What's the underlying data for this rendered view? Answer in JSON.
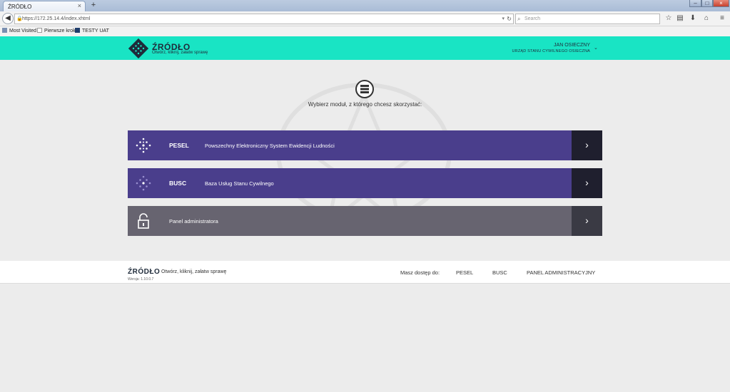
{
  "browser": {
    "tab_title": "ŹRÓDŁO",
    "tab_close": "×",
    "new_tab": "+",
    "url": "https://172.25.14.4/index.xhtml",
    "search_placeholder": "Search",
    "window_controls": {
      "minimize": "–",
      "maximize": "□",
      "close": "×"
    },
    "bookmarks": [
      "Most Visited",
      "Pierwsze kroki",
      "TESTY UAT"
    ]
  },
  "header": {
    "app_name": "ŹRÓDŁO",
    "tagline": "Otwórz, kliknij, załatw sprawę",
    "user_name": "JAN OSIECZNY",
    "user_org": "URZĄD STANU CYWILNEGO OSIECZNA",
    "brand_color": "#19e4c4"
  },
  "main": {
    "prompt": "Wybierz moduł, z którego chcesz skorzystać:",
    "modules": [
      {
        "code": "PESEL",
        "description": "Powszechny Elektroniczny System Ewidencji Ludności",
        "color": "#4a3e8c",
        "icon": "dots-diamond-icon"
      },
      {
        "code": "BUSC",
        "description": "Baza Usług Stanu Cywilnego",
        "color": "#4a3e8c",
        "icon": "dots-diamond-faded-icon"
      },
      {
        "label": "Panel administratora",
        "color": "#676470",
        "icon": "unlock-icon"
      }
    ],
    "arrow": "›"
  },
  "footer": {
    "app_name": "ŹRÓDŁO",
    "tagline": "Otwórz, kliknij, załatw sprawę",
    "version": "Wersja: 1.10.0.7",
    "access_label": "Masz dostęp do:",
    "links": [
      "PESEL",
      "BUSC",
      "PANEL ADMINISTRACYJNY"
    ]
  }
}
